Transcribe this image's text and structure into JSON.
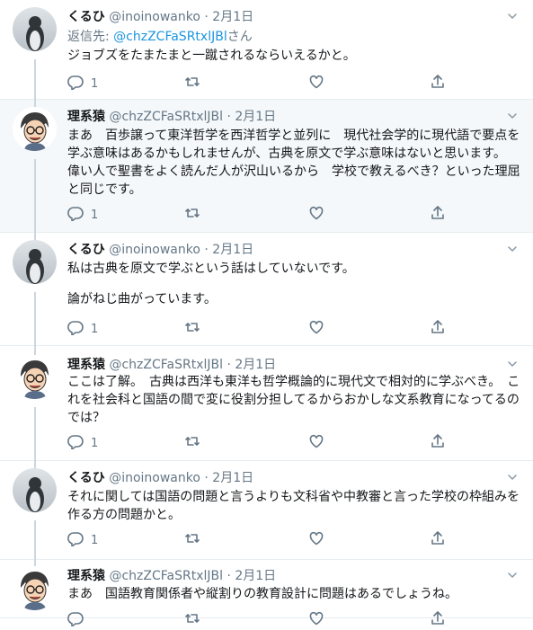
{
  "tweets": [
    {
      "author": "くるひ",
      "handle": "@inoinowanko",
      "dot": "·",
      "date": "2月1日",
      "avatar": "penguin-avatar",
      "reply_to": {
        "prefix": "返信先: ",
        "link": "@chzZCFaSRtxlJBl",
        "suffix": "さん"
      },
      "paragraphs": [
        "ジョブズをたまたまと一蹴されるならいえるかと。"
      ],
      "reply_count": "1"
    },
    {
      "author": "理系猿",
      "handle": "@chzZCFaSRtxlJBl",
      "dot": "·",
      "date": "2月1日",
      "avatar": "cartoon-man-avatar",
      "paragraphs": [
        "まあ　百歩譲って東洋哲学を西洋哲学と並列に　現代社会学的に現代語で要点を学ぶ意味はあるかもしれませんが、古典を原文で学ぶ意味はないと思います。　偉い人で聖書をよく読んだ人が沢山いるから　学校で教えるべき？といった理屈と同じです。"
      ],
      "reply_count": "1"
    },
    {
      "author": "くるひ",
      "handle": "@inoinowanko",
      "dot": "·",
      "date": "2月1日",
      "avatar": "penguin-avatar",
      "paragraphs": [
        "私は古典を原文で学ぶという話はしていないです。",
        "論がねじ曲がっています。"
      ],
      "reply_count": "1"
    },
    {
      "author": "理系猿",
      "handle": "@chzZCFaSRtxlJBl",
      "dot": "·",
      "date": "2月1日",
      "avatar": "cartoon-man-avatar",
      "paragraphs": [
        "ここは了解。　古典は西洋も東洋も哲学概論的に現代文で相対的に学ぶべき。　これを社会科と国語の間で変に役割分担してるからおかしな文系教育になってるのでは？"
      ],
      "reply_count": "1"
    },
    {
      "author": "くるひ",
      "handle": "@inoinowanko",
      "dot": "·",
      "date": "2月1日",
      "avatar": "penguin-avatar",
      "paragraphs": [
        "それに関しては国語の問題と言うよりも文科省や中教審と言った学校の枠組みを作る方の問題かと。"
      ],
      "reply_count": "1"
    },
    {
      "author": "理系猿",
      "handle": "@chzZCFaSRtxlJBl",
      "dot": "·",
      "date": "2月1日",
      "avatar": "cartoon-man-avatar",
      "paragraphs": [
        "まあ　国語教育関係者や縦割りの教育設計に問題はあるでしょうね。"
      ],
      "reply_count": ""
    }
  ],
  "icons": {
    "reply": "reply-icon",
    "retweet": "retweet-icon",
    "like": "heart-icon",
    "share": "share-icon",
    "more": "chevron-down-icon"
  },
  "colors": {
    "link": "#1b95e0",
    "muted": "#657786",
    "highlight_bg": "#f5f8fa",
    "thread_line": "#ccd6dd"
  }
}
